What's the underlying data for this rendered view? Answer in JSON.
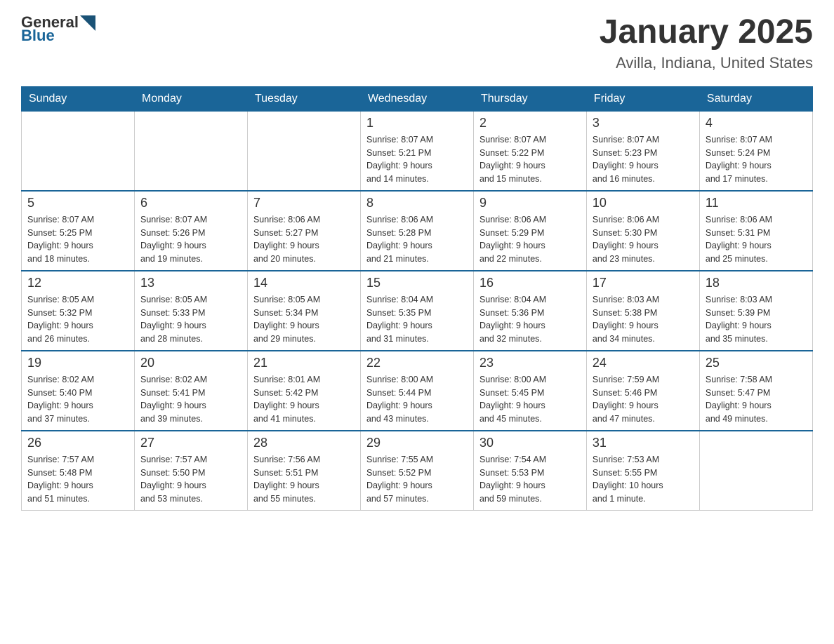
{
  "logo": {
    "general": "General",
    "blue": "Blue"
  },
  "title": "January 2025",
  "subtitle": "Avilla, Indiana, United States",
  "days": [
    "Sunday",
    "Monday",
    "Tuesday",
    "Wednesday",
    "Thursday",
    "Friday",
    "Saturday"
  ],
  "weeks": [
    [
      {
        "day": "",
        "info": ""
      },
      {
        "day": "",
        "info": ""
      },
      {
        "day": "",
        "info": ""
      },
      {
        "day": "1",
        "info": "Sunrise: 8:07 AM\nSunset: 5:21 PM\nDaylight: 9 hours\nand 14 minutes."
      },
      {
        "day": "2",
        "info": "Sunrise: 8:07 AM\nSunset: 5:22 PM\nDaylight: 9 hours\nand 15 minutes."
      },
      {
        "day": "3",
        "info": "Sunrise: 8:07 AM\nSunset: 5:23 PM\nDaylight: 9 hours\nand 16 minutes."
      },
      {
        "day": "4",
        "info": "Sunrise: 8:07 AM\nSunset: 5:24 PM\nDaylight: 9 hours\nand 17 minutes."
      }
    ],
    [
      {
        "day": "5",
        "info": "Sunrise: 8:07 AM\nSunset: 5:25 PM\nDaylight: 9 hours\nand 18 minutes."
      },
      {
        "day": "6",
        "info": "Sunrise: 8:07 AM\nSunset: 5:26 PM\nDaylight: 9 hours\nand 19 minutes."
      },
      {
        "day": "7",
        "info": "Sunrise: 8:06 AM\nSunset: 5:27 PM\nDaylight: 9 hours\nand 20 minutes."
      },
      {
        "day": "8",
        "info": "Sunrise: 8:06 AM\nSunset: 5:28 PM\nDaylight: 9 hours\nand 21 minutes."
      },
      {
        "day": "9",
        "info": "Sunrise: 8:06 AM\nSunset: 5:29 PM\nDaylight: 9 hours\nand 22 minutes."
      },
      {
        "day": "10",
        "info": "Sunrise: 8:06 AM\nSunset: 5:30 PM\nDaylight: 9 hours\nand 23 minutes."
      },
      {
        "day": "11",
        "info": "Sunrise: 8:06 AM\nSunset: 5:31 PM\nDaylight: 9 hours\nand 25 minutes."
      }
    ],
    [
      {
        "day": "12",
        "info": "Sunrise: 8:05 AM\nSunset: 5:32 PM\nDaylight: 9 hours\nand 26 minutes."
      },
      {
        "day": "13",
        "info": "Sunrise: 8:05 AM\nSunset: 5:33 PM\nDaylight: 9 hours\nand 28 minutes."
      },
      {
        "day": "14",
        "info": "Sunrise: 8:05 AM\nSunset: 5:34 PM\nDaylight: 9 hours\nand 29 minutes."
      },
      {
        "day": "15",
        "info": "Sunrise: 8:04 AM\nSunset: 5:35 PM\nDaylight: 9 hours\nand 31 minutes."
      },
      {
        "day": "16",
        "info": "Sunrise: 8:04 AM\nSunset: 5:36 PM\nDaylight: 9 hours\nand 32 minutes."
      },
      {
        "day": "17",
        "info": "Sunrise: 8:03 AM\nSunset: 5:38 PM\nDaylight: 9 hours\nand 34 minutes."
      },
      {
        "day": "18",
        "info": "Sunrise: 8:03 AM\nSunset: 5:39 PM\nDaylight: 9 hours\nand 35 minutes."
      }
    ],
    [
      {
        "day": "19",
        "info": "Sunrise: 8:02 AM\nSunset: 5:40 PM\nDaylight: 9 hours\nand 37 minutes."
      },
      {
        "day": "20",
        "info": "Sunrise: 8:02 AM\nSunset: 5:41 PM\nDaylight: 9 hours\nand 39 minutes."
      },
      {
        "day": "21",
        "info": "Sunrise: 8:01 AM\nSunset: 5:42 PM\nDaylight: 9 hours\nand 41 minutes."
      },
      {
        "day": "22",
        "info": "Sunrise: 8:00 AM\nSunset: 5:44 PM\nDaylight: 9 hours\nand 43 minutes."
      },
      {
        "day": "23",
        "info": "Sunrise: 8:00 AM\nSunset: 5:45 PM\nDaylight: 9 hours\nand 45 minutes."
      },
      {
        "day": "24",
        "info": "Sunrise: 7:59 AM\nSunset: 5:46 PM\nDaylight: 9 hours\nand 47 minutes."
      },
      {
        "day": "25",
        "info": "Sunrise: 7:58 AM\nSunset: 5:47 PM\nDaylight: 9 hours\nand 49 minutes."
      }
    ],
    [
      {
        "day": "26",
        "info": "Sunrise: 7:57 AM\nSunset: 5:48 PM\nDaylight: 9 hours\nand 51 minutes."
      },
      {
        "day": "27",
        "info": "Sunrise: 7:57 AM\nSunset: 5:50 PM\nDaylight: 9 hours\nand 53 minutes."
      },
      {
        "day": "28",
        "info": "Sunrise: 7:56 AM\nSunset: 5:51 PM\nDaylight: 9 hours\nand 55 minutes."
      },
      {
        "day": "29",
        "info": "Sunrise: 7:55 AM\nSunset: 5:52 PM\nDaylight: 9 hours\nand 57 minutes."
      },
      {
        "day": "30",
        "info": "Sunrise: 7:54 AM\nSunset: 5:53 PM\nDaylight: 9 hours\nand 59 minutes."
      },
      {
        "day": "31",
        "info": "Sunrise: 7:53 AM\nSunset: 5:55 PM\nDaylight: 10 hours\nand 1 minute."
      },
      {
        "day": "",
        "info": ""
      }
    ]
  ]
}
